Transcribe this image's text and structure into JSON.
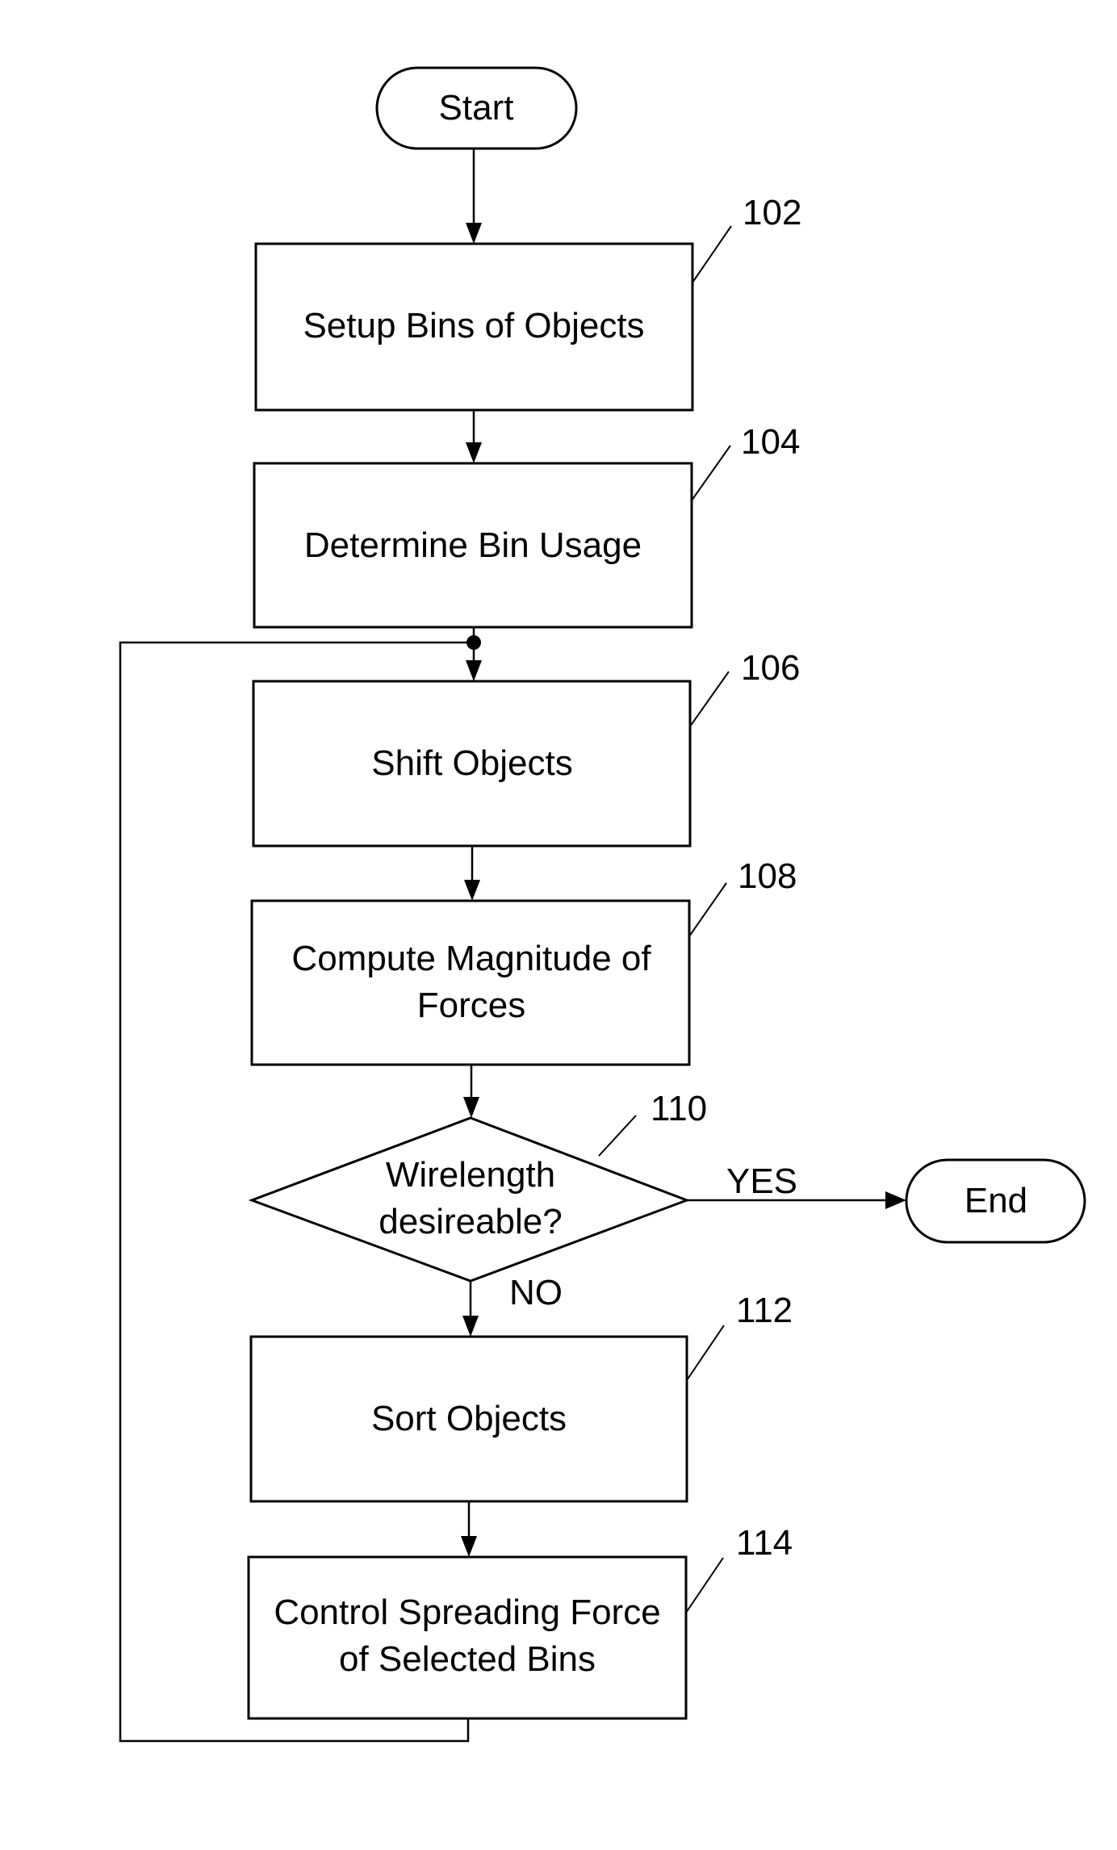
{
  "diagram": {
    "type": "flowchart",
    "terminals": {
      "start": "Start",
      "end": "End"
    },
    "steps": [
      {
        "id": "102",
        "label_lines": [
          "Setup Bins of Objects"
        ]
      },
      {
        "id": "104",
        "label_lines": [
          "Determine Bin Usage"
        ]
      },
      {
        "id": "106",
        "label_lines": [
          "Shift Objects"
        ]
      },
      {
        "id": "108",
        "label_lines": [
          "Compute Magnitude of",
          "Forces"
        ]
      },
      {
        "id": "112",
        "label_lines": [
          "Sort Objects"
        ]
      },
      {
        "id": "114",
        "label_lines": [
          "Control Spreading Force",
          "of Selected Bins"
        ]
      }
    ],
    "decision": {
      "id": "110",
      "label_lines": [
        "Wirelength",
        "desireable?"
      ],
      "yes_label": "YES",
      "no_label": "NO"
    },
    "edges": [
      {
        "from": "Start",
        "to": "102"
      },
      {
        "from": "102",
        "to": "104"
      },
      {
        "from": "104",
        "to": "106"
      },
      {
        "from": "106",
        "to": "108"
      },
      {
        "from": "108",
        "to": "110"
      },
      {
        "from": "110",
        "to": "End",
        "label": "YES"
      },
      {
        "from": "110",
        "to": "112",
        "label": "NO"
      },
      {
        "from": "112",
        "to": "114"
      },
      {
        "from": "114",
        "to": "106",
        "note": "loop back"
      }
    ]
  }
}
